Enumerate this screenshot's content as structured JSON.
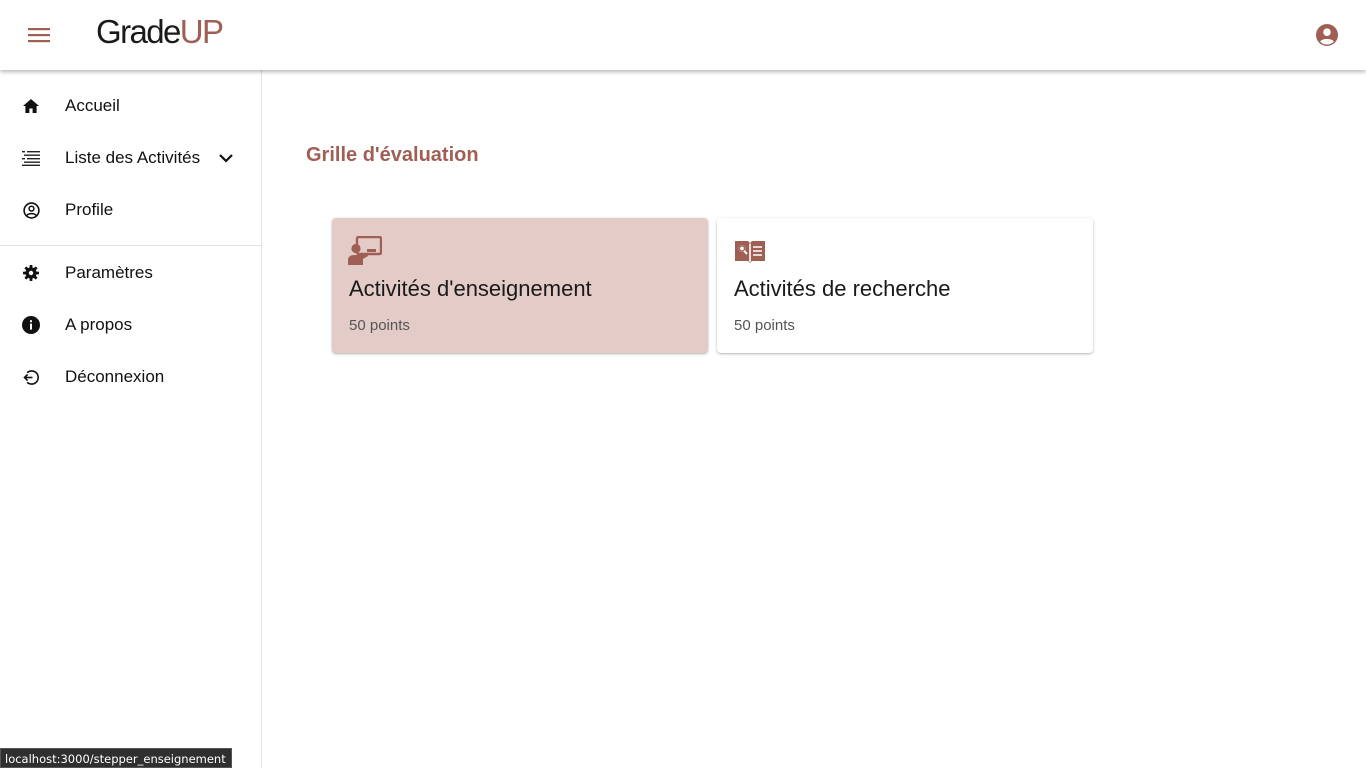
{
  "header": {
    "logo_part1": "Grade",
    "logo_part2": "UP",
    "menu_icon": "hamburger-icon",
    "account_icon": "account-circle-icon",
    "brand_color": "#a05f54"
  },
  "sidebar": {
    "items": [
      {
        "label": "Accueil",
        "icon": "home-icon"
      },
      {
        "label": "Liste des Activités",
        "icon": "list-icon",
        "expand_icon": "chevron-down-icon"
      },
      {
        "label": "Profile",
        "icon": "account-circle-outline-icon"
      },
      {
        "label": "Paramètres",
        "icon": "gear-icon"
      },
      {
        "label": "A propos",
        "icon": "info-icon"
      },
      {
        "label": "Déconnexion",
        "icon": "logout-icon"
      }
    ]
  },
  "main": {
    "title": "Grille d'évaluation",
    "cards": [
      {
        "title": "Activités d'enseignement",
        "subtitle": "50 points",
        "icon": "teacher-board-icon",
        "selected": true
      },
      {
        "title": "Activités de recherche",
        "subtitle": "50 points",
        "icon": "book-search-icon",
        "selected": false
      }
    ]
  },
  "status_bar": {
    "url": "localhost:3000/stepper_enseignement"
  }
}
